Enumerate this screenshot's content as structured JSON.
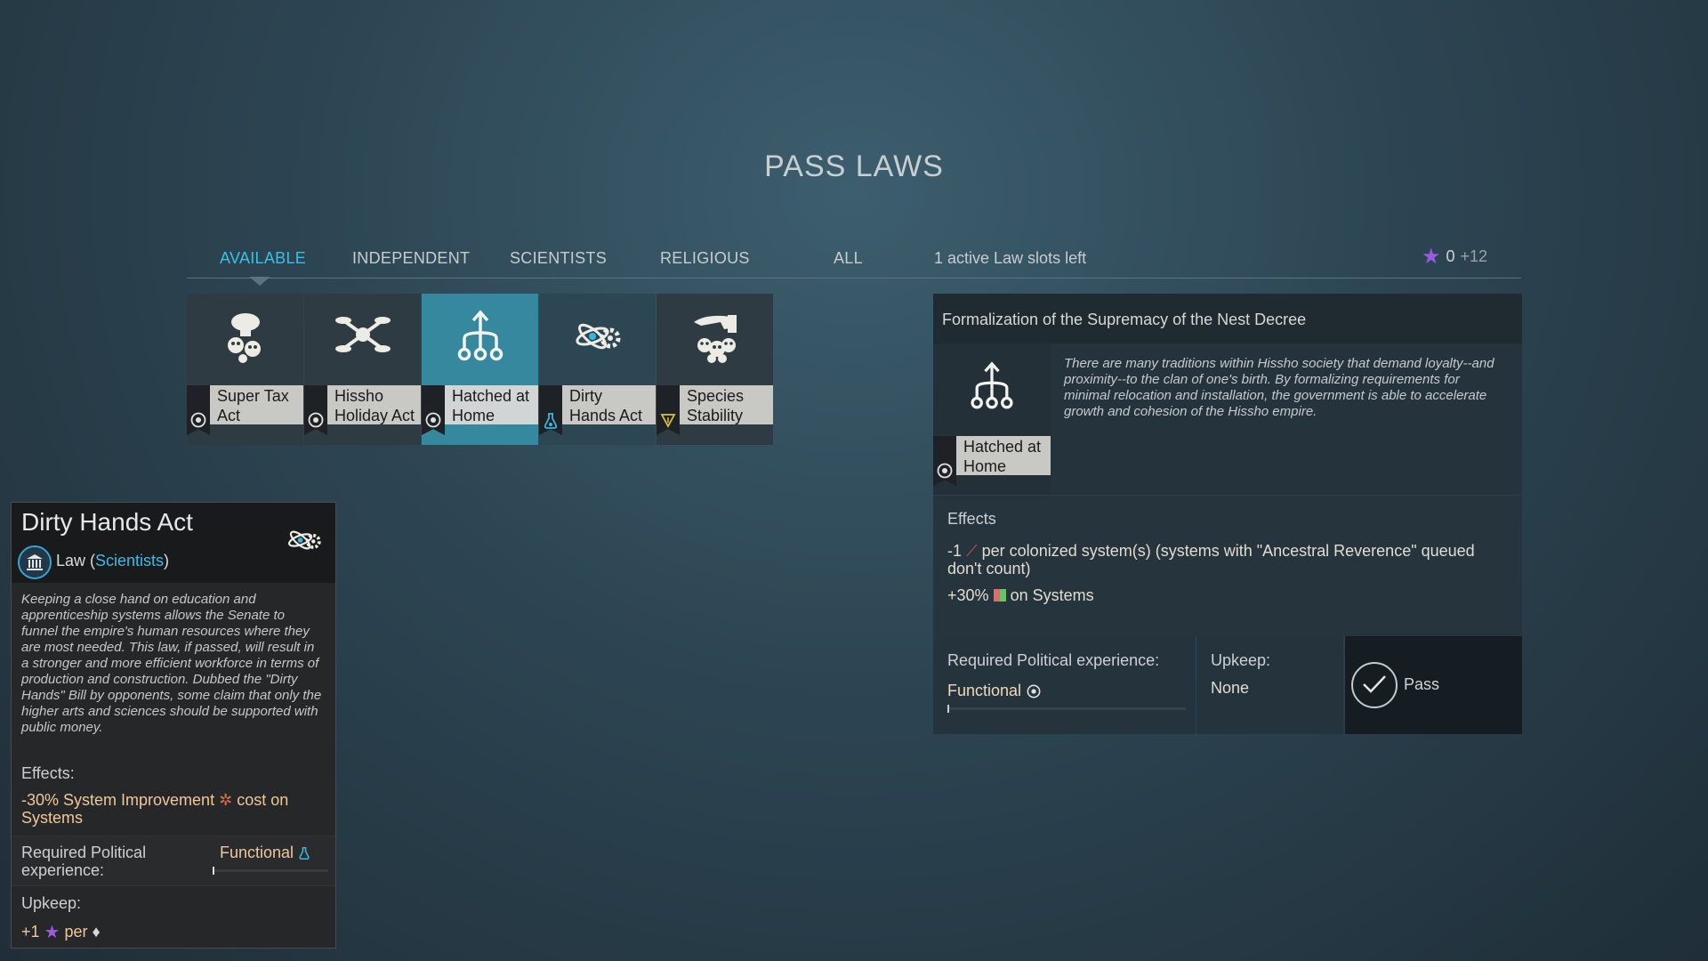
{
  "screen": {
    "title": "PASS LAWS"
  },
  "tabs": [
    {
      "label": "AVAILABLE",
      "active": true
    },
    {
      "label": "INDEPENDENT"
    },
    {
      "label": "SCIENTISTS"
    },
    {
      "label": "RELIGIOUS"
    },
    {
      "label": "ALL"
    }
  ],
  "slots_left": "1 active Law slots left",
  "influence": {
    "value": "0",
    "gain": "+12",
    "icon": "star-icon",
    "color": "#9b5be0"
  },
  "laws": [
    {
      "name": "Super Tax Act",
      "line1": "Super Tax",
      "line2": "Act",
      "icon": "tax-faces-icon",
      "faction_icon": "target-icon"
    },
    {
      "name": "Hissho Holiday Act",
      "line1": "Hissho",
      "line2": "Holiday Act",
      "icon": "drone-icon",
      "faction_icon": "target-icon"
    },
    {
      "name": "Hatched at Home",
      "line1": "Hatched at",
      "line2": "Home",
      "icon": "nest-tree-icon",
      "faction_icon": "target-icon",
      "selected": true
    },
    {
      "name": "Dirty Hands Act",
      "line1": "Dirty",
      "line2": "Hands Act",
      "icon": "atom-gear-icon",
      "faction_icon": "flask-icon"
    },
    {
      "name": "Species Stability",
      "line1": "Species",
      "line2": "Stability",
      "icon": "hand-skulls-icon",
      "faction_icon": "triangle-icon"
    }
  ],
  "detail": {
    "heading": "Formalization of the Supremacy of the Nest Decree",
    "law_label_1": "Hatched at",
    "law_label_2": "Home",
    "description": "There are many traditions within Hissho society that demand loyalty--and proximity--to the clan of one's birth. By formalizing requirements for minimal relocation and installation, the government is able to accelerate growth and cohesion of the Hissho empire.",
    "effects_heading": "Effects",
    "effect1_prefix": "-1",
    "effect1_text": "per colonized system(s) (systems with \"Ancestral Reverence\" queued don't count)",
    "effect2_prefix": "+30%",
    "effect2_text": "on Systems",
    "req_heading": "Required Political experience:",
    "req_value": "Functional",
    "upkeep_heading": "Upkeep:",
    "upkeep_value": "None",
    "pass_label": "Pass"
  },
  "tooltip": {
    "title": "Dirty Hands Act",
    "law_word": "Law (",
    "faction": "Scientists",
    "close_paren": ")",
    "description": "Keeping a close hand on education and apprenticeship systems allows the Senate to funnel the empire's human resources where they are most needed. This law, if passed, will result in a stronger and more efficient workforce in terms of production and construction. Dubbed the \"Dirty Hands\" Bill by opponents, some claim that only the higher arts and sciences should be supported with public money.",
    "effects_heading": "Effects:",
    "effect_a": "-30% System Improvement",
    "effect_b": "cost on Systems",
    "req_heading": "Required Political experience:",
    "req_value": "Functional",
    "upkeep_heading": "Upkeep:",
    "upkeep_value": "+1",
    "upkeep_per": "per"
  }
}
